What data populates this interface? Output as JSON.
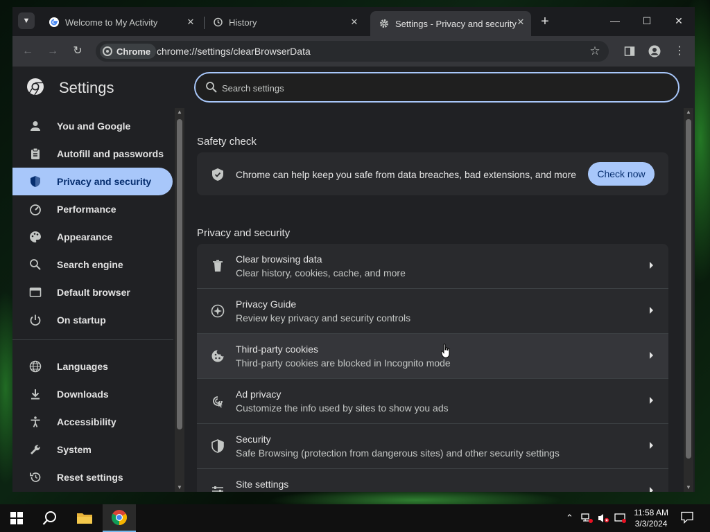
{
  "browser": {
    "tabs": [
      {
        "label": "Welcome to My Activity",
        "favicon": "google-g-icon",
        "active": false
      },
      {
        "label": "History",
        "favicon": "history-icon",
        "active": false
      },
      {
        "label": "Settings - Privacy and security",
        "favicon": "gear-icon",
        "active": true
      }
    ],
    "omnibox": {
      "chip_label": "Chrome",
      "url": "chrome://settings/clearBrowserData"
    }
  },
  "settings": {
    "title": "Settings",
    "search_placeholder": "Search settings",
    "nav": [
      {
        "label": "You and Google",
        "icon": "person-icon",
        "active": false
      },
      {
        "label": "Autofill and passwords",
        "icon": "clipboard-icon",
        "active": false
      },
      {
        "label": "Privacy and security",
        "icon": "shield-icon",
        "active": true
      },
      {
        "label": "Performance",
        "icon": "speedometer-icon",
        "active": false
      },
      {
        "label": "Appearance",
        "icon": "palette-icon",
        "active": false
      },
      {
        "label": "Search engine",
        "icon": "search-icon",
        "active": false
      },
      {
        "label": "Default browser",
        "icon": "browser-window-icon",
        "active": false
      },
      {
        "label": "On startup",
        "icon": "power-icon",
        "active": false
      },
      {
        "label": "Languages",
        "icon": "globe-icon",
        "active": false
      },
      {
        "label": "Downloads",
        "icon": "download-icon",
        "active": false
      },
      {
        "label": "Accessibility",
        "icon": "accessibility-icon",
        "active": false
      },
      {
        "label": "System",
        "icon": "wrench-icon",
        "active": false
      },
      {
        "label": "Reset settings",
        "icon": "reset-history-icon",
        "active": false
      }
    ],
    "safety_check": {
      "title": "Safety check",
      "text": "Chrome can help keep you safe from data breaches, bad extensions, and more",
      "button": "Check now"
    },
    "privacy": {
      "title": "Privacy and security",
      "rows": [
        {
          "title": "Clear browsing data",
          "subtitle": "Clear history, cookies, cache, and more",
          "icon": "trash-icon"
        },
        {
          "title": "Privacy Guide",
          "subtitle": "Review key privacy and security controls",
          "icon": "compass-icon"
        },
        {
          "title": "Third-party cookies",
          "subtitle": "Third-party cookies are blocked in Incognito mode",
          "icon": "cookie-icon"
        },
        {
          "title": "Ad privacy",
          "subtitle": "Customize the info used by sites to show you ads",
          "icon": "ad-privacy-icon"
        },
        {
          "title": "Security",
          "subtitle": "Safe Browsing (protection from dangerous sites) and other security settings",
          "icon": "shield-icon"
        },
        {
          "title": "Site settings",
          "subtitle": "",
          "icon": "sliders-icon"
        }
      ]
    }
  },
  "taskbar": {
    "time": "11:58 AM",
    "date": "3/3/2024"
  },
  "colors": {
    "accent": "#a8c7fa",
    "accent_text": "#062e6f",
    "background": "#202124",
    "card": "#292a2d"
  }
}
